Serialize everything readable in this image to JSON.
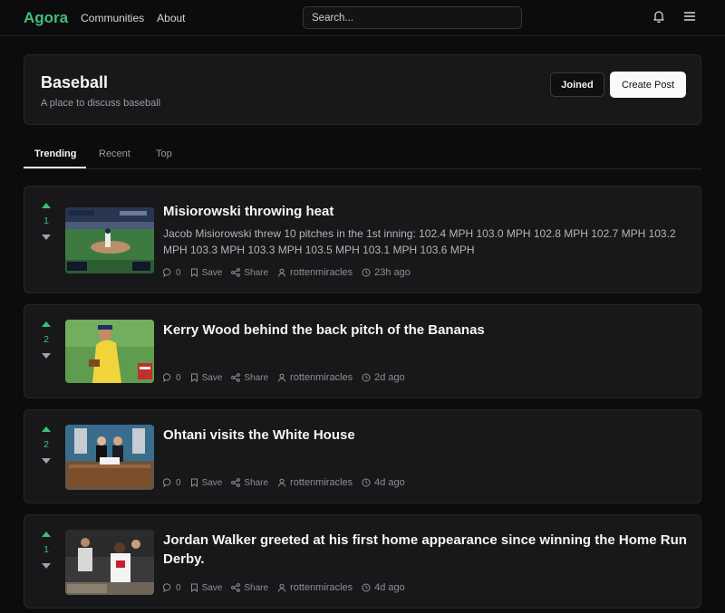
{
  "nav": {
    "logo": "Agora",
    "links": [
      "Communities",
      "About"
    ],
    "search_placeholder": "Search..."
  },
  "community": {
    "title": "Baseball",
    "description": "A place to discuss baseball",
    "joined_label": "Joined",
    "create_label": "Create Post"
  },
  "tabs": [
    "Trending",
    "Recent",
    "Top"
  ],
  "active_tab": "Trending",
  "posts": [
    {
      "votes": "1",
      "title": "Misiorowski throwing heat",
      "body": "Jacob Misiorowski threw 10 pitches in the 1st inning: 102.4 MPH 103.0 MPH 102.8 MPH 102.7 MPH 103.2 MPH 103.3 MPH 103.3 MPH 103.5 MPH 103.1 MPH 103.6 MPH",
      "comments": "0",
      "save": "Save",
      "share": "Share",
      "user": "rottenmiracles",
      "time": "23h ago"
    },
    {
      "votes": "2",
      "title": "Kerry Wood behind the back pitch of the Bananas",
      "body": "",
      "comments": "0",
      "save": "Save",
      "share": "Share",
      "user": "rottenmiracles",
      "time": "2d ago"
    },
    {
      "votes": "2",
      "title": "Ohtani visits the White House",
      "body": "",
      "comments": "0",
      "save": "Save",
      "share": "Share",
      "user": "rottenmiracles",
      "time": "4d ago"
    },
    {
      "votes": "1",
      "title": "Jordan Walker greeted at his first home appearance since winning the Home Run Derby.",
      "body": "",
      "comments": "0",
      "save": "Save",
      "share": "Share",
      "user": "rottenmiracles",
      "time": "4d ago"
    }
  ],
  "colors": {
    "accent": "#3fbf7a",
    "background": "#0c0c0e",
    "card": "#18181b"
  }
}
